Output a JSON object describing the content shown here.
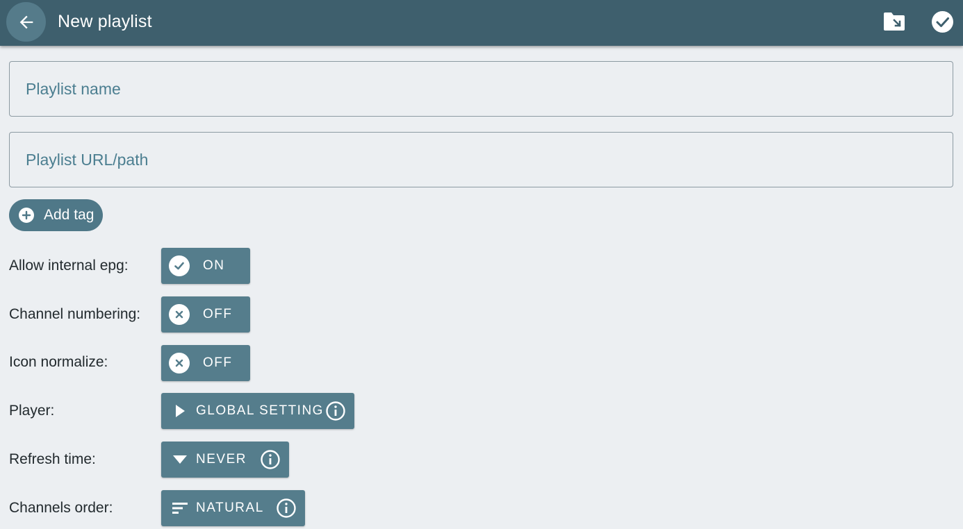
{
  "header": {
    "title": "New playlist",
    "back_icon": "arrow-back-icon",
    "import_icon": "folder-import-icon",
    "save_icon": "check-circle-icon"
  },
  "form": {
    "name_placeholder": "Playlist name",
    "url_placeholder": "Playlist URL/path",
    "add_tag_label": "Add tag"
  },
  "settings": {
    "allow_internal_epg": {
      "label": "Allow internal epg:",
      "value": "ON",
      "icon": "check-icon"
    },
    "channel_numbering": {
      "label": "Channel numbering:",
      "value": "OFF",
      "icon": "close-icon"
    },
    "icon_normalize": {
      "label": "Icon normalize:",
      "value": "OFF",
      "icon": "close-icon"
    },
    "player": {
      "label": "Player:",
      "value": "GLOBAL SETTING",
      "icon": "play-icon"
    },
    "refresh_time": {
      "label": "Refresh time:",
      "value": "NEVER",
      "icon": "dropdown-triangle-icon"
    },
    "channels_order": {
      "label": "Channels order:",
      "value": "NATURAL",
      "icon": "sort-icon"
    }
  },
  "colors": {
    "toolbar": "#3e5f6d",
    "accent": "#557d8c",
    "background": "#eceff2",
    "hint_text": "#4b7e90"
  }
}
